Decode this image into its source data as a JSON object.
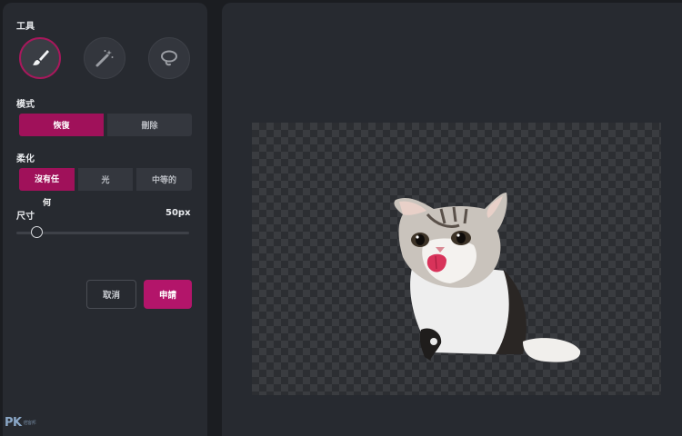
{
  "tools": {
    "label": "工具",
    "items": [
      {
        "name": "brush-icon",
        "active": true
      },
      {
        "name": "magic-wand-icon",
        "active": false
      },
      {
        "name": "lasso-icon",
        "active": false
      }
    ]
  },
  "mode": {
    "label": "模式",
    "options": [
      "恢復",
      "刪除"
    ],
    "selected": "恢復"
  },
  "softness": {
    "label": "柔化",
    "options": [
      "沒有任何",
      "光",
      "中等的"
    ],
    "selected": "沒有任何"
  },
  "size": {
    "label": "尺寸",
    "value": "50px",
    "slider_fraction": 0.12
  },
  "actions": {
    "cancel": "取消",
    "apply": "申請"
  },
  "watermark": {
    "brand": "PK",
    "sub": "痞客邦"
  },
  "colors": {
    "accent": "#a0115a",
    "panel": "#272a30",
    "background": "#1b1d21"
  }
}
